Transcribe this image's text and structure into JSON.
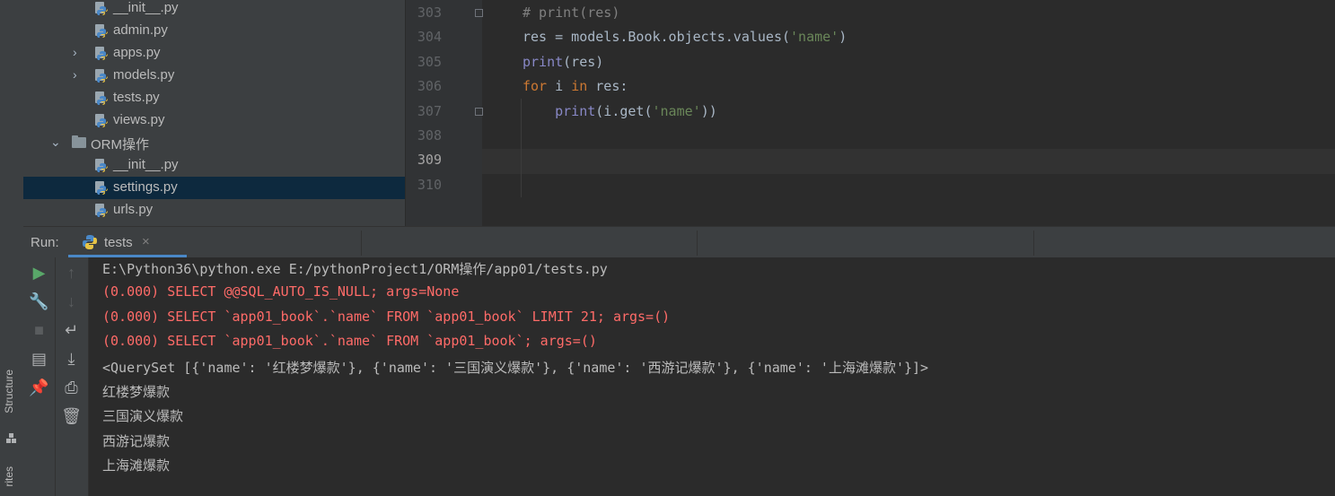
{
  "side_tabs": {
    "structure": "Structure",
    "favorites": "rites"
  },
  "tree": {
    "items": [
      {
        "label": "__init__.py",
        "type": "py",
        "chev": ""
      },
      {
        "label": "admin.py",
        "type": "py",
        "chev": ""
      },
      {
        "label": "apps.py",
        "type": "py",
        "chev": "›"
      },
      {
        "label": "models.py",
        "type": "py",
        "chev": "›"
      },
      {
        "label": "tests.py",
        "type": "py",
        "chev": ""
      },
      {
        "label": "views.py",
        "type": "py",
        "chev": ""
      },
      {
        "label": "ORM操作",
        "type": "folder",
        "chev": "⌄"
      },
      {
        "label": "__init__.py",
        "type": "py",
        "chev": ""
      },
      {
        "label": "settings.py",
        "type": "py",
        "chev": "",
        "selected": true
      },
      {
        "label": "urls.py",
        "type": "py",
        "chev": ""
      }
    ]
  },
  "editor": {
    "lines": [
      {
        "num": "303",
        "segs": [
          [
            "cm",
            "# print(res)"
          ]
        ]
      },
      {
        "num": "304",
        "segs": [
          [
            "",
            "res = models.Book.objects.values("
          ],
          [
            "str",
            "'name'"
          ],
          [
            "",
            ")"
          ]
        ]
      },
      {
        "num": "305",
        "segs": [
          [
            "bi",
            "print"
          ],
          [
            "",
            "(res)"
          ]
        ]
      },
      {
        "num": "306",
        "segs": [
          [
            "kw",
            "for"
          ],
          [
            "",
            " i "
          ],
          [
            "kw",
            "in"
          ],
          [
            "",
            " res:"
          ]
        ]
      },
      {
        "num": "307",
        "segs": [
          [
            "",
            "    "
          ],
          [
            "bi",
            "print"
          ],
          [
            "",
            "(i.get("
          ],
          [
            "str",
            "'name'"
          ],
          [
            "",
            "))"
          ]
        ]
      },
      {
        "num": "308",
        "segs": []
      },
      {
        "num": "309",
        "segs": []
      },
      {
        "num": "310",
        "segs": []
      }
    ]
  },
  "run": {
    "label": "Run:",
    "tab_title": "tests",
    "tab_close": "×",
    "console": [
      {
        "text": "E:\\Python36\\python.exe E:/pythonProject1/ORM操作/app01/tests.py",
        "kind": "normal"
      },
      {
        "text": "(0.000) SELECT @@SQL_AUTO_IS_NULL; args=None",
        "kind": "err"
      },
      {
        "text": "(0.000) SELECT `app01_book`.`name` FROM `app01_book` LIMIT 21; args=()",
        "kind": "err"
      },
      {
        "text": "(0.000) SELECT `app01_book`.`name` FROM `app01_book`; args=()",
        "kind": "err"
      },
      {
        "text": "<QuerySet [{'name': '红楼梦爆款'}, {'name': '三国演义爆款'}, {'name': '西游记爆款'}, {'name': '上海滩爆款'}]>",
        "kind": "normal"
      },
      {
        "text": "红楼梦爆款",
        "kind": "normal"
      },
      {
        "text": "三国演义爆款",
        "kind": "normal"
      },
      {
        "text": "西游记爆款",
        "kind": "normal"
      },
      {
        "text": "上海滩爆款",
        "kind": "normal"
      }
    ]
  },
  "toolbar_left": [
    {
      "name": "rerun-icon",
      "glyph": "▶",
      "color": "#59a869"
    },
    {
      "name": "wrench-icon",
      "glyph": "🔧",
      "color": "#afb1b3"
    },
    {
      "name": "stop-icon",
      "glyph": "■",
      "color": "#5a5d5f"
    },
    {
      "name": "layout-icon",
      "glyph": "▤",
      "color": "#afb1b3"
    },
    {
      "name": "pin-icon",
      "glyph": "📌",
      "color": "#afb1b3"
    }
  ],
  "toolbar_right": [
    {
      "name": "up-arrow-icon",
      "glyph": "↑",
      "color": "#5a5d5f"
    },
    {
      "name": "down-arrow-icon",
      "glyph": "↓",
      "color": "#5a5d5f"
    },
    {
      "name": "soft-wrap-icon",
      "glyph": "↵",
      "color": "#afb1b3"
    },
    {
      "name": "scroll-to-end-icon",
      "glyph": "⤓",
      "color": "#afb1b3"
    },
    {
      "name": "print-icon",
      "glyph": "⎙",
      "color": "#afb1b3"
    },
    {
      "name": "trash-icon",
      "glyph": "🗑",
      "color": "#afb1b3"
    }
  ]
}
